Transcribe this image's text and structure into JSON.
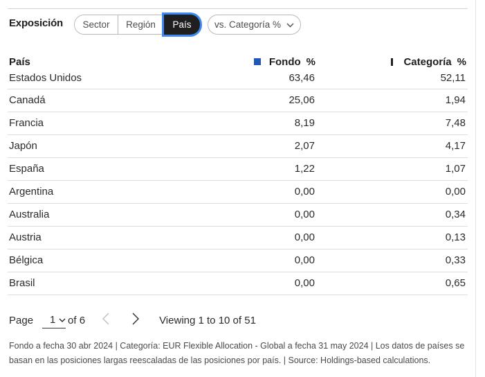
{
  "exposure": {
    "title": "Exposición",
    "tabs": [
      {
        "label": "Sector",
        "active": false
      },
      {
        "label": "Región",
        "active": false
      },
      {
        "label": "País",
        "active": true
      }
    ],
    "compare_dropdown": {
      "label": "vs. Categoría %"
    }
  },
  "table": {
    "headers": {
      "name": "País",
      "fondo": "Fondo",
      "categoria": "Categoría",
      "pct": "%"
    },
    "rows": [
      {
        "name": "Estados Unidos",
        "fondo": "63,46",
        "categoria": "52,11"
      },
      {
        "name": "Canadá",
        "fondo": "25,06",
        "categoria": "1,94"
      },
      {
        "name": "Francia",
        "fondo": "8,19",
        "categoria": "7,48"
      },
      {
        "name": "Japón",
        "fondo": "2,07",
        "categoria": "4,17"
      },
      {
        "name": "España",
        "fondo": "1,22",
        "categoria": "1,07"
      },
      {
        "name": "Argentina",
        "fondo": "0,00",
        "categoria": "0,00"
      },
      {
        "name": "Australia",
        "fondo": "0,00",
        "categoria": "0,34"
      },
      {
        "name": "Austria",
        "fondo": "0,00",
        "categoria": "0,13"
      },
      {
        "name": "Bélgica",
        "fondo": "0,00",
        "categoria": "0,33"
      },
      {
        "name": "Brasil",
        "fondo": "0,00",
        "categoria": "0,65"
      }
    ]
  },
  "pagination": {
    "page_label": "Page",
    "current_page": "1",
    "of_label": "of 6",
    "viewing": "Viewing 1 to 10 of 51"
  },
  "footnote": "Fondo a fecha 30 abr 2024 | Categoría: EUR Flexible Allocation - Global a fecha 31 may 2024 | Los datos de países se basan en las posiciones largas reescaladas de las posiciones por país. | Source: Holdings-based calculations.",
  "colors": {
    "fondo_marker": "#1f58b8",
    "categoria_marker": "#1f1f1f",
    "focus_ring": "#3d8bf2",
    "active_tab_bg": "#1f1f1f"
  },
  "icons": {
    "dropdown": "chevron-down-icon",
    "prev": "chevron-left-icon",
    "next": "chevron-right-icon"
  }
}
